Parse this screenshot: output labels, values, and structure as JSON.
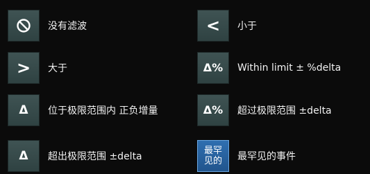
{
  "filter_options": {
    "no_filter": {
      "label": "没有滤波",
      "icon": "no-filter-icon"
    },
    "less_than": {
      "label": "小于",
      "icon_text": "<"
    },
    "greater_than": {
      "label": "大于",
      "icon_text": ">"
    },
    "within_limit_pct": {
      "label": "Within limit ± %delta",
      "icon_text": "Δ%"
    },
    "within_limit_delta": {
      "label": "位于极限范围内 正负增量",
      "icon_text": "Δ"
    },
    "exceed_limit_pct": {
      "label": "超过极限范围 ±delta",
      "icon_text": "Δ%"
    },
    "outside_limit_delta": {
      "label": "超出极限范围 ±delta",
      "icon_text": "Δ"
    },
    "rarest_event": {
      "label": "最罕见的事件",
      "icon_text": "最罕见的",
      "selected": true
    }
  },
  "colors": {
    "background": "#0b0b0b",
    "button": "#384b4b",
    "button_selected": "#2a64a3",
    "text": "#f2f2f2"
  }
}
